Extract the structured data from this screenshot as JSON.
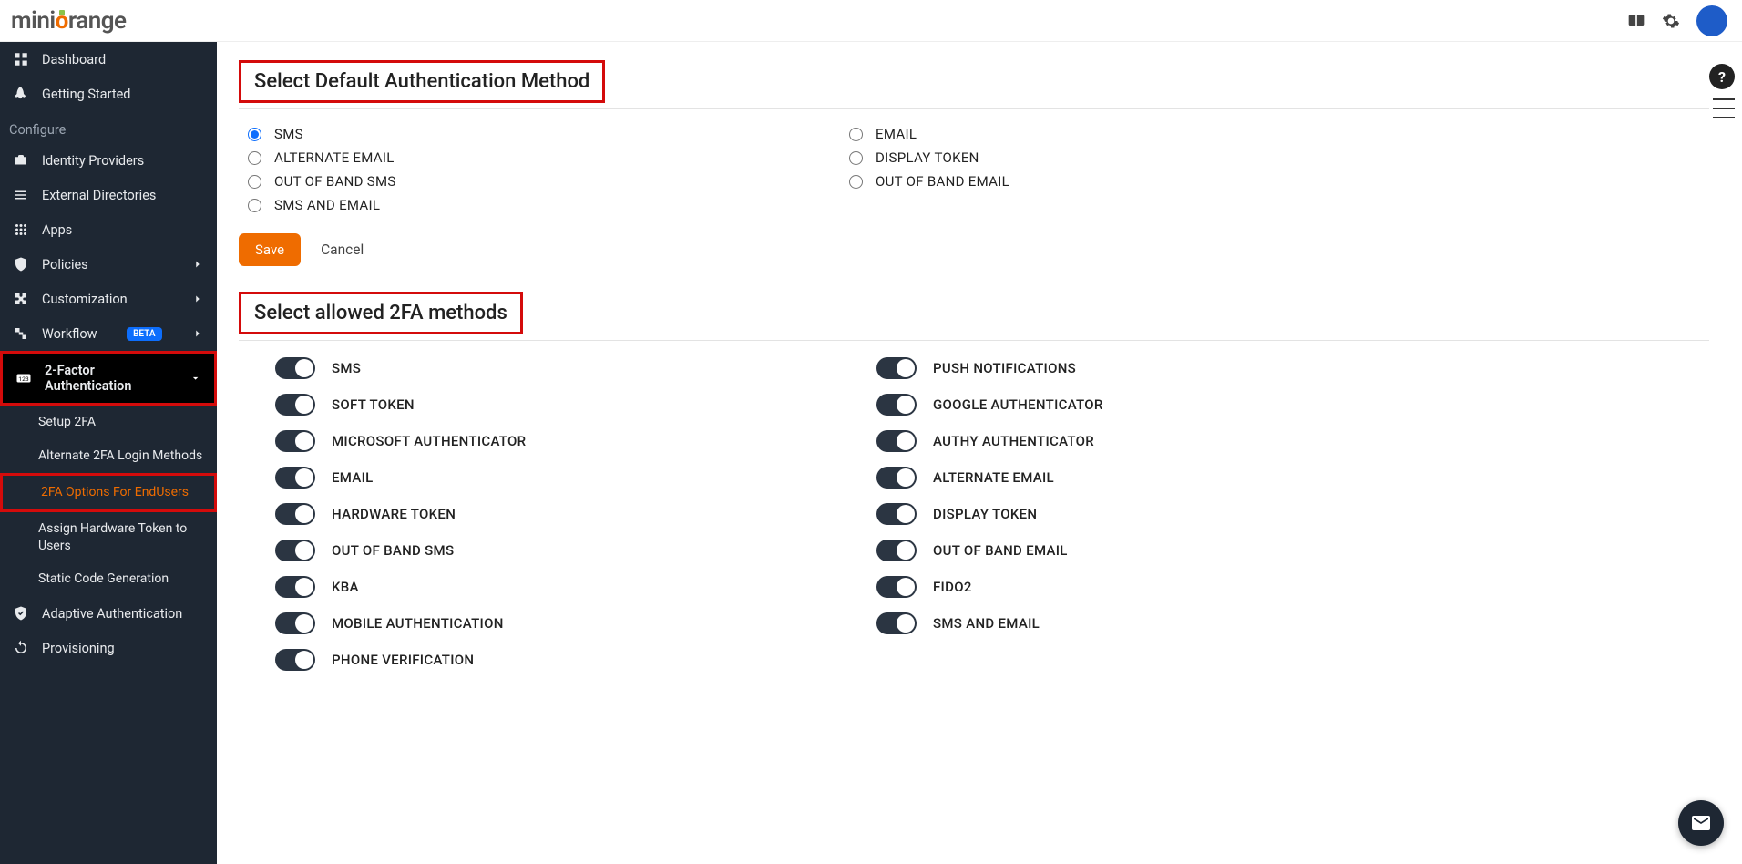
{
  "logo": {
    "pre": "mini",
    "accent": "o",
    "post": "range"
  },
  "sidebar": {
    "top": [
      {
        "label": "Dashboard",
        "icon": "grid"
      },
      {
        "label": "Getting Started",
        "icon": "rocket"
      }
    ],
    "configure_label": "Configure",
    "configure": [
      {
        "label": "Identity Providers",
        "icon": "briefcase"
      },
      {
        "label": "External Directories",
        "icon": "list"
      },
      {
        "label": "Apps",
        "icon": "apps"
      },
      {
        "label": "Policies",
        "icon": "shield",
        "chev": true
      },
      {
        "label": "Customization",
        "icon": "puzzle",
        "chev": true
      },
      {
        "label": "Workflow",
        "icon": "flow",
        "chev": true,
        "beta": "BETA"
      }
    ],
    "twofa": {
      "label": "2-Factor Authentication",
      "icon": "123",
      "chev": true
    },
    "twofa_sub": [
      {
        "label": "Setup 2FA"
      },
      {
        "label": "Alternate 2FA Login Methods"
      },
      {
        "label": "2FA Options For EndUsers",
        "active": true
      },
      {
        "label": "Assign Hardware Token to Users"
      },
      {
        "label": "Static Code Generation"
      }
    ],
    "tail": [
      {
        "label": "Adaptive Authentication",
        "icon": "check-shield"
      },
      {
        "label": "Provisioning",
        "icon": "sync"
      }
    ]
  },
  "sections": {
    "default_method": "Select Default Authentication Method",
    "allowed": "Select allowed 2FA methods"
  },
  "radios": {
    "left": [
      {
        "label": "SMS",
        "checked": true
      },
      {
        "label": "ALTERNATE EMAIL"
      },
      {
        "label": "OUT OF BAND SMS"
      },
      {
        "label": "SMS AND EMAIL"
      }
    ],
    "right": [
      {
        "label": "EMAIL"
      },
      {
        "label": "DISPLAY TOKEN"
      },
      {
        "label": "OUT OF BAND EMAIL"
      }
    ]
  },
  "buttons": {
    "save": "Save",
    "cancel": "Cancel"
  },
  "toggles": {
    "left": [
      "SMS",
      "SOFT TOKEN",
      "MICROSOFT AUTHENTICATOR",
      "EMAIL",
      "HARDWARE TOKEN",
      "OUT OF BAND SMS",
      "KBA",
      "MOBILE AUTHENTICATION",
      "PHONE VERIFICATION"
    ],
    "right": [
      "PUSH NOTIFICATIONS",
      "GOOGLE AUTHENTICATOR",
      "AUTHY AUTHENTICATOR",
      "ALTERNATE EMAIL",
      "DISPLAY TOKEN",
      "OUT OF BAND EMAIL",
      "FIDO2",
      "SMS AND EMAIL"
    ]
  }
}
